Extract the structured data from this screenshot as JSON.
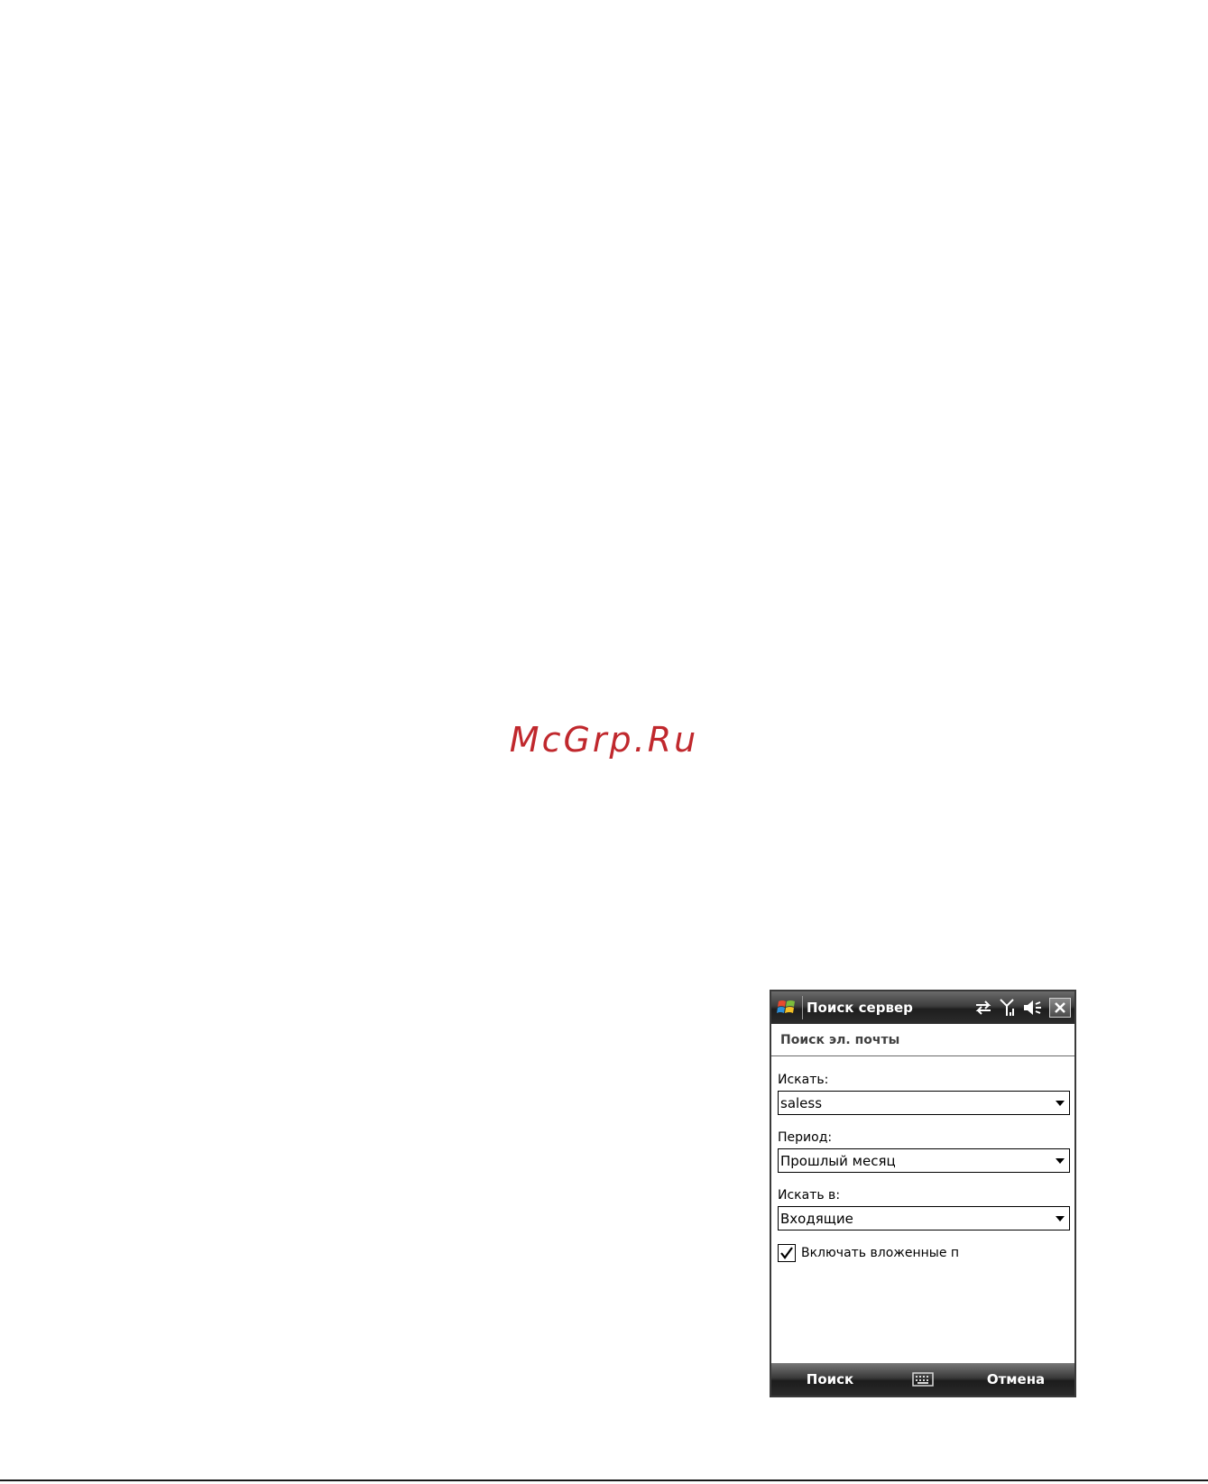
{
  "watermark": {
    "text": "McGrp.Ru"
  },
  "device": {
    "title_bar": {
      "title": "Поиск сервер",
      "icons": [
        "windows-start-icon",
        "sync-arrows-icon",
        "signal-antenna-icon",
        "speaker-muted-icon",
        "close-icon"
      ]
    },
    "subheader": {
      "text": "Поиск эл. почты"
    },
    "form": {
      "search_label": "Искать:",
      "search_value": "saless",
      "period_label": "Период:",
      "period_value": "Прошлый месяц",
      "location_label": "Искать в:",
      "location_value": "Входящие",
      "attachments_label": "Включать вложенные п",
      "attachments_checked": true
    },
    "softkeys": {
      "left": "Поиск",
      "right": "Отмена",
      "center_icon": "keyboard-icon"
    }
  },
  "colors": {
    "watermark": "#c0282d",
    "bar_dark": "#1e1e1e"
  }
}
